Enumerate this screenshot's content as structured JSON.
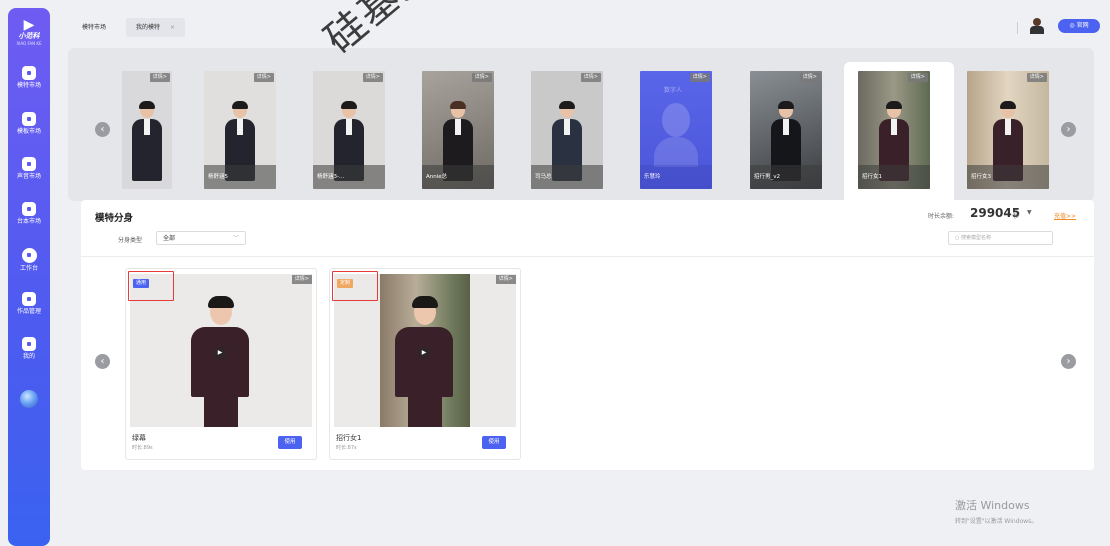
{
  "app": {
    "logo_text": "小范科",
    "logo_subtext": "XIAO FAN KE"
  },
  "sidebar": {
    "items": [
      {
        "label": "模特市场",
        "icon": "avatar-icon"
      },
      {
        "label": "模板市场",
        "icon": "template-icon"
      },
      {
        "label": "声音市场",
        "icon": "voice-icon"
      },
      {
        "label": "台本市场",
        "icon": "script-icon"
      },
      {
        "label": "工作台",
        "icon": "workbench-icon",
        "active": true
      },
      {
        "label": "作品管理",
        "icon": "works-icon"
      },
      {
        "label": "我的",
        "icon": "user-icon"
      }
    ]
  },
  "tabs": [
    {
      "label": "模特市场"
    },
    {
      "label": "我的模特",
      "close": "×"
    }
  ],
  "header": {
    "official_site": "◎ 官网"
  },
  "carousel": {
    "detail_label": "详情>",
    "prev": "‹",
    "next": "›",
    "items": [
      {
        "name": ""
      },
      {
        "name": "杨舒涵5"
      },
      {
        "name": "杨舒涵3-..."
      },
      {
        "name": "Annie总"
      },
      {
        "name": "司马总"
      },
      {
        "name": "乐慧玲",
        "placeholder_text": "数字人"
      },
      {
        "name": "招行男_v2"
      },
      {
        "name": "招行女1"
      },
      {
        "name": "招行女3"
      }
    ]
  },
  "section": {
    "title": "模特分身",
    "filter_label": "分身类型",
    "filter_value": "全部",
    "time_label": "时长余额:",
    "time_value": "299045",
    "time_unit": "秒",
    "time_caret": "▼",
    "recharge": "充值>>",
    "search_placeholder": "搜索模型名称"
  },
  "avatars": [
    {
      "tag": "通用",
      "tag_type": "general",
      "name": "绿幕",
      "duration": "时长:89s",
      "use": "使用",
      "detail": "详情>"
    },
    {
      "tag": "定制",
      "tag_type": "custom",
      "name": "招行女1",
      "duration": "时长:87s",
      "use": "使用",
      "detail": "详情>"
    }
  ],
  "watermark": "硅基原创",
  "windows_activation": {
    "title": "激活 Windows",
    "subtitle": "转到\"设置\"以激活 Windows。"
  },
  "colors": {
    "accent": "#4b63f0",
    "sidebar_top": "#6f5cf2",
    "recharge": "#f08a24",
    "highlight_box": "#e53b3b"
  }
}
